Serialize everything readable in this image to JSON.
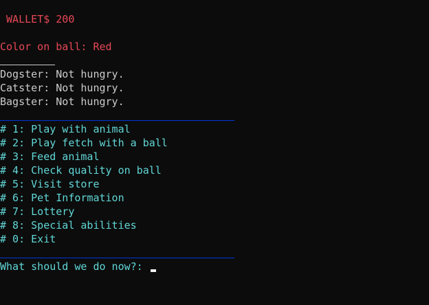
{
  "wallet": {
    "text": " WALLET$ 200"
  },
  "ball": {
    "text": "Color on ball: Red"
  },
  "pets": [
    "Dogster: Not hungry.",
    "Catster: Not hungry.",
    "Bagster: Not hungry."
  ],
  "menu": [
    "# 1: Play with animal",
    "# 2: Play fetch with a ball",
    "# 3: Feed animal",
    "# 4: Check quality on ball",
    "# 5: Visit store",
    "# 6: Pet Information",
    "# 7: Lottery",
    "# 8: Special abilities",
    "# 0: Exit"
  ],
  "prompt": {
    "text": "What should we do now?: ",
    "input_value": ""
  },
  "colors": {
    "background": "#0c0c0c",
    "red": "#e74856",
    "white": "#cccccc",
    "cyan": "#61d6d6",
    "rule_blue": "#0037da"
  }
}
